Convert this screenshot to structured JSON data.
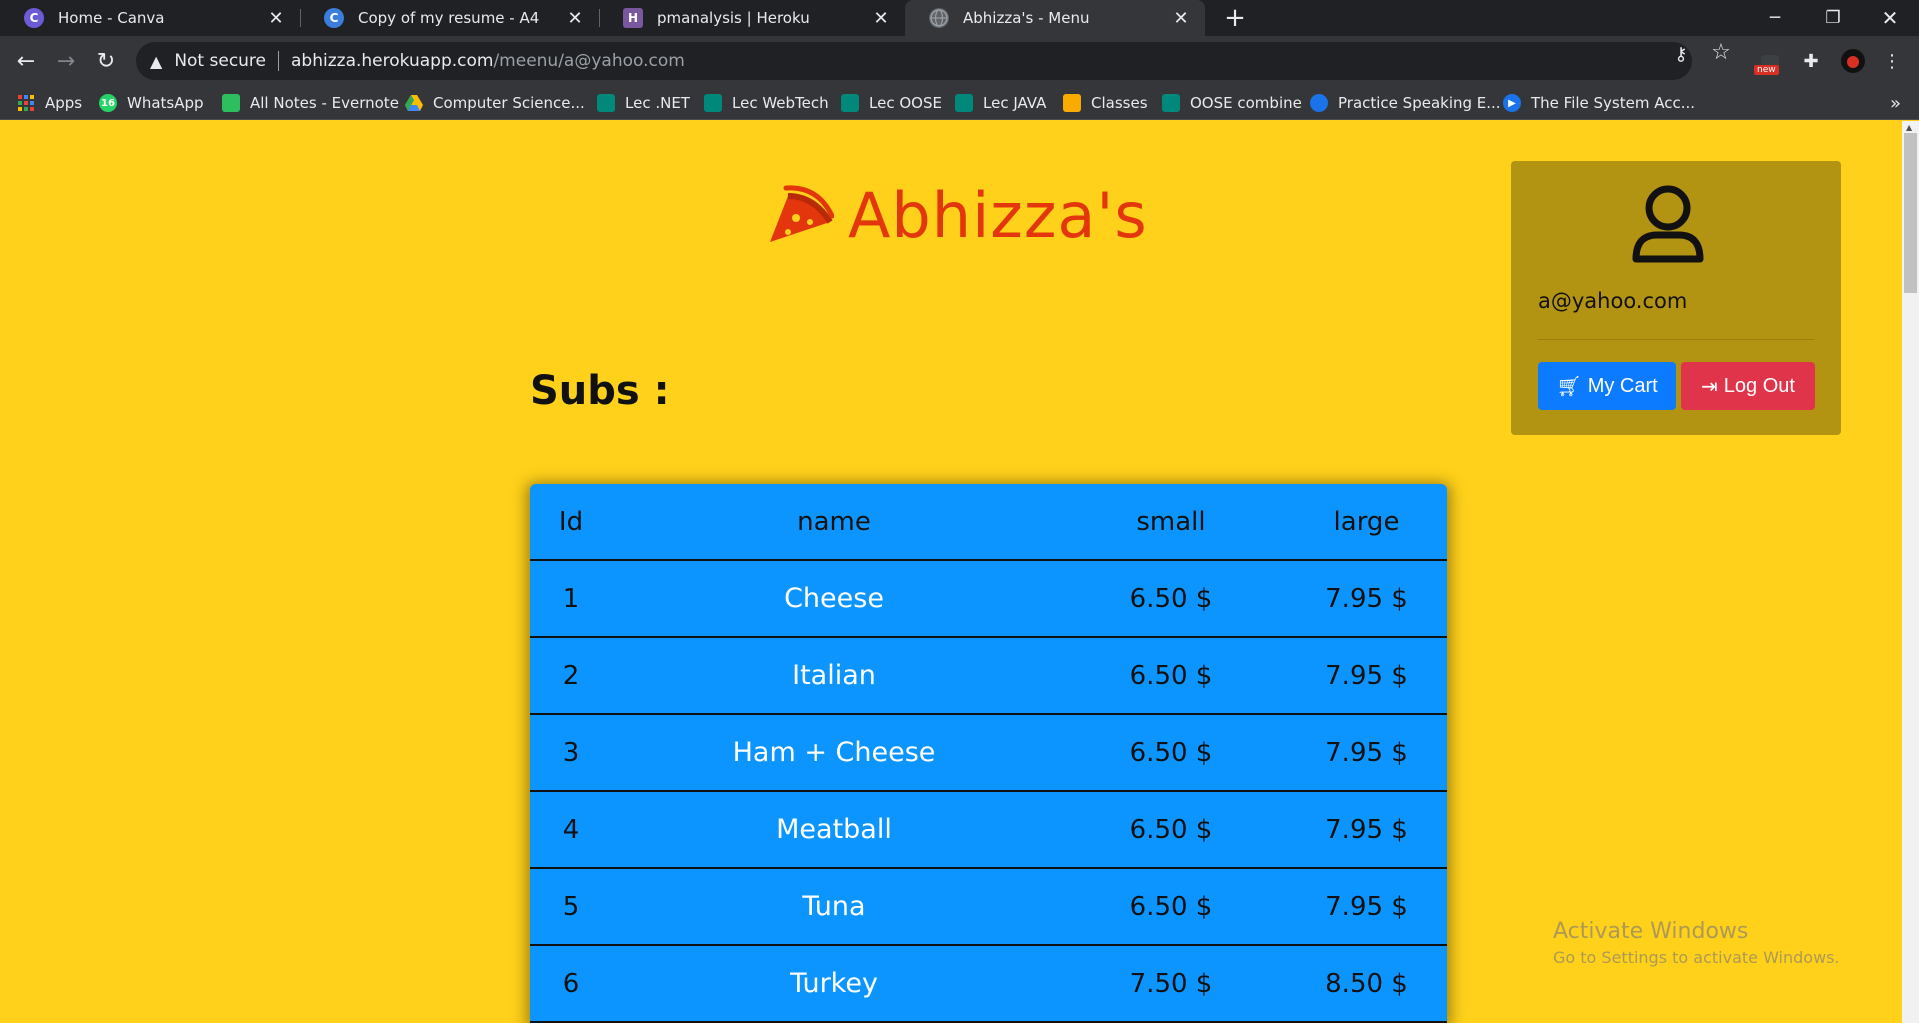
{
  "browser": {
    "tabs": [
      {
        "title": "Home - Canva",
        "favicon": "canva-icon",
        "favicon_color": "#6b5bd6",
        "favicon_text": "C"
      },
      {
        "title": "Copy of my resume - A4",
        "favicon": "canva-icon",
        "favicon_color": "#3b7ddb",
        "favicon_text": "C"
      },
      {
        "title": "pmanalysis | Heroku",
        "favicon": "heroku-icon",
        "favicon_color": "#79589f",
        "favicon_text": "H"
      },
      {
        "title": "Abhizza's - Menu",
        "favicon": "globe-icon",
        "favicon_color": "#5f6368",
        "favicon_text": ""
      }
    ],
    "address": {
      "security_label": "Not secure",
      "host": "abhizza.herokuapp.com",
      "path": "/meenu/a@yahoo.com"
    },
    "extension_badge": "new",
    "bookmarks": [
      {
        "label": "Apps",
        "icon": "apps-grid-icon",
        "color": "#ea4335"
      },
      {
        "label": "WhatsApp",
        "icon": "whatsapp-icon",
        "color": "#25d366",
        "icon_text": "16"
      },
      {
        "label": "All Notes - Evernote",
        "icon": "evernote-icon",
        "color": "#2dbe60"
      },
      {
        "label": "Computer Science...",
        "icon": "google-drive-icon",
        "color": "#fbbc04"
      },
      {
        "label": "Lec .NET",
        "icon": "google-meet-icon",
        "color": "#00897b"
      },
      {
        "label": "Lec WebTech",
        "icon": "google-meet-icon",
        "color": "#00897b"
      },
      {
        "label": "Lec OOSE",
        "icon": "google-meet-icon",
        "color": "#00897b"
      },
      {
        "label": "Lec JAVA",
        "icon": "google-meet-icon",
        "color": "#00897b"
      },
      {
        "label": "Classes",
        "icon": "google-classroom-icon",
        "color": "#f9ab00"
      },
      {
        "label": "OOSE combine",
        "icon": "google-meet-icon",
        "color": "#00897b"
      },
      {
        "label": "Practice Speaking E...",
        "icon": "globe-blue-icon",
        "color": "#1a73e8"
      },
      {
        "label": "The File System Acc...",
        "icon": "play-arrow-icon",
        "color": "#1a73e8"
      }
    ]
  },
  "page": {
    "brand_name": "Abhizza's",
    "section_title": "Subs :",
    "table": {
      "headers": [
        "Id",
        "name",
        "small",
        "large"
      ],
      "rows": [
        {
          "id": "1",
          "name": "Cheese",
          "small": "6.50 $",
          "large": "7.95 $"
        },
        {
          "id": "2",
          "name": "Italian",
          "small": "6.50 $",
          "large": "7.95 $"
        },
        {
          "id": "3",
          "name": "Ham + Cheese",
          "small": "6.50 $",
          "large": "7.95 $"
        },
        {
          "id": "4",
          "name": "Meatball",
          "small": "6.50 $",
          "large": "7.95 $"
        },
        {
          "id": "5",
          "name": "Tuna",
          "small": "6.50 $",
          "large": "7.95 $"
        },
        {
          "id": "6",
          "name": "Turkey",
          "small": "7.50 $",
          "large": "8.50 $"
        }
      ]
    },
    "user": {
      "email": "a@yahoo.com",
      "cart_label": "My Cart",
      "logout_label": "Log Out"
    },
    "watermark": {
      "title": "Activate Windows",
      "subtitle": "Go to Settings to activate Windows."
    }
  },
  "colors": {
    "page_bg": "#ffd11a",
    "brand": "#e3360c",
    "table_bg": "#0d95ff",
    "card_bg": "#b39312",
    "cart_btn": "#0d7bff",
    "logout_btn": "#e0344b"
  }
}
